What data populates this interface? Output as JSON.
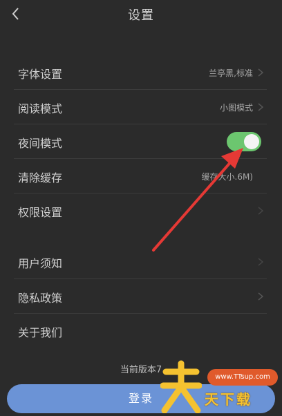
{
  "header": {
    "title": "设置",
    "back_icon": "chevron-left-icon"
  },
  "settings": {
    "font": {
      "label": "字体设置",
      "value": "兰亭黑,标准"
    },
    "reading_mode": {
      "label": "阅读模式",
      "value": "小图模式"
    },
    "night_mode": {
      "label": "夜间模式",
      "enabled": true,
      "toggle_color": "#6cc66f"
    },
    "clear_cache": {
      "label": "清除缓存",
      "value": "缓存大小.6M)"
    },
    "permissions": {
      "label": "权限设置"
    },
    "user_notice": {
      "label": "用户须知"
    },
    "privacy_policy": {
      "label": "隐私政策"
    },
    "about_us": {
      "label": "关于我们"
    }
  },
  "footer": {
    "version_text": "当前版本7",
    "login_label": "登录",
    "login_color": "#6b93d6"
  },
  "annotation": {
    "arrow_color": "#e53935"
  },
  "watermark": {
    "site": "www.TTsup.com",
    "brand": "天下载"
  }
}
